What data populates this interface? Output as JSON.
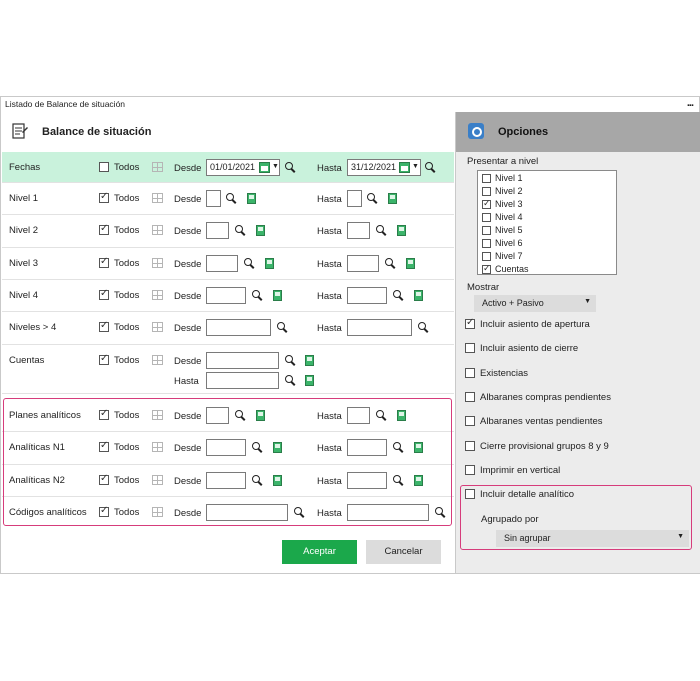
{
  "window": {
    "title": "Listado de Balance de situación",
    "menu_dots": "..."
  },
  "left": {
    "title": "Balance de situación",
    "rows": [
      {
        "label": "Fechas",
        "todos": "Todos",
        "checked": false,
        "desde": "Desde",
        "desde_value": "01/01/2021",
        "hasta": "Hasta",
        "hasta_value": "31/12/2021"
      },
      {
        "label": "Nivel 1",
        "todos": "Todos",
        "checked": true,
        "desde": "Desde",
        "hasta": "Hasta"
      },
      {
        "label": "Nivel 2",
        "todos": "Todos",
        "checked": true,
        "desde": "Desde",
        "hasta": "Hasta"
      },
      {
        "label": "Nivel 3",
        "todos": "Todos",
        "checked": true,
        "desde": "Desde",
        "hasta": "Hasta"
      },
      {
        "label": "Nivel 4",
        "todos": "Todos",
        "checked": true,
        "desde": "Desde",
        "hasta": "Hasta"
      },
      {
        "label": "Niveles > 4",
        "todos": "Todos",
        "checked": true,
        "desde": "Desde",
        "hasta": "Hasta"
      },
      {
        "label": "Cuentas",
        "todos": "Todos",
        "checked": true,
        "desde": "Desde",
        "hasta": "Hasta"
      },
      {
        "label": "Planes analíticos",
        "todos": "Todos",
        "checked": true,
        "desde": "Desde",
        "hasta": "Hasta"
      },
      {
        "label": "Analíticas  N1",
        "todos": "Todos",
        "checked": true,
        "desde": "Desde",
        "hasta": "Hasta"
      },
      {
        "label": "Analíticas  N2",
        "todos": "Todos",
        "checked": true,
        "desde": "Desde",
        "hasta": "Hasta"
      },
      {
        "label": "Códigos analíticos",
        "todos": "Todos",
        "checked": true,
        "desde": "Desde",
        "hasta": "Hasta"
      }
    ],
    "accept": "Aceptar",
    "cancel": "Cancelar"
  },
  "right": {
    "title": "Opciones",
    "presentar_label": "Presentar a nivel",
    "levels": [
      {
        "label": "Nivel 1",
        "checked": false
      },
      {
        "label": "Nivel 2",
        "checked": false
      },
      {
        "label": "Nivel 3",
        "checked": true
      },
      {
        "label": "Nivel 4",
        "checked": false
      },
      {
        "label": "Nivel 5",
        "checked": false
      },
      {
        "label": "Nivel 6",
        "checked": false
      },
      {
        "label": "Nivel 7",
        "checked": false
      },
      {
        "label": "Cuentas",
        "checked": true
      }
    ],
    "mostrar_label": "Mostrar",
    "mostrar_value": "Activo + Pasivo",
    "options": [
      {
        "label": "Incluir asiento de apertura",
        "checked": true
      },
      {
        "label": "Incluir asiento de cierre",
        "checked": false
      },
      {
        "label": "Existencias",
        "checked": false
      },
      {
        "label": "Albaranes compras pendientes",
        "checked": false
      },
      {
        "label": "Albaranes ventas pendientes",
        "checked": false
      },
      {
        "label": "Cierre provisional grupos 8 y 9",
        "checked": false
      },
      {
        "label": "Imprimir en vertical",
        "checked": false
      },
      {
        "label": "Incluir detalle analítico",
        "checked": false
      }
    ],
    "agrupado_label": "Agrupado por",
    "agrupado_value": "Sin agrupar"
  },
  "colors": {
    "accent_green": "#1ba84b",
    "highlight": "#d63c7b",
    "fechas_bg": "#c9f2dc"
  }
}
